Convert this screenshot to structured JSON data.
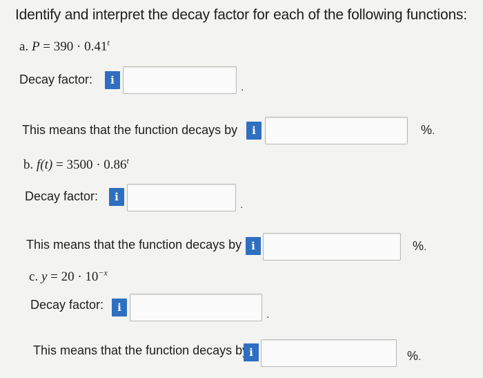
{
  "question": "Identify and interpret the decay factor for each of the following functions:",
  "info_glyph": "i",
  "parts": [
    {
      "letter": "a.",
      "lhs": "P",
      "coef": "390",
      "base": "0.41",
      "exponent": "t",
      "decay_label": "Decay factor:",
      "decay_tail": ".",
      "decays_label": "This means that the function decays by",
      "percent": "%",
      "percent_tail": "."
    },
    {
      "letter": "b.",
      "lhs": "f(t)",
      "coef": "3500",
      "base": "0.86",
      "exponent": "t",
      "decay_label": "Decay factor:",
      "decay_tail": ".",
      "decays_label": "This means that the function decays by",
      "percent": "%",
      "percent_tail": "."
    },
    {
      "letter": "c.",
      "lhs": "y",
      "coef": "20",
      "base": "10",
      "exponent": "−x",
      "decay_label": "Decay factor:",
      "decay_tail": ".",
      "decays_label": "This means that the function decays by",
      "percent": "%",
      "percent_tail": "."
    }
  ]
}
